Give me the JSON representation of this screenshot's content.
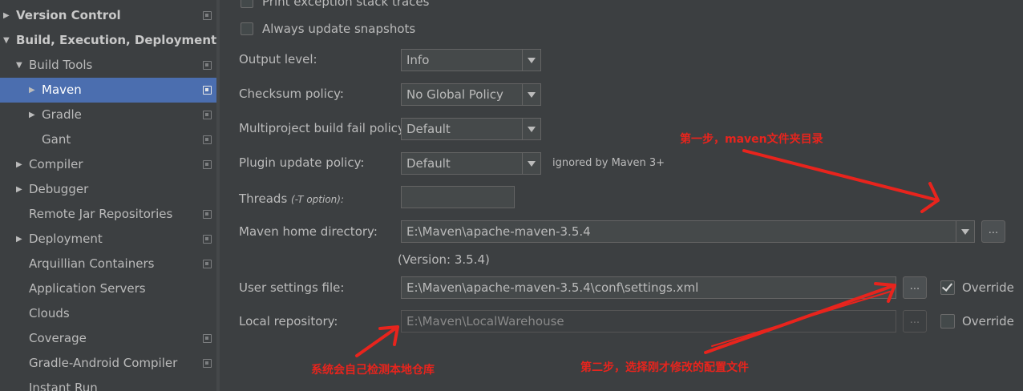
{
  "sidebar": {
    "items": [
      {
        "label": "Version Control",
        "level": 0,
        "bold": true,
        "arrow": "right",
        "copy": true
      },
      {
        "label": "Build, Execution, Deployment",
        "level": 0,
        "bold": true,
        "arrow": "down",
        "copy": false
      },
      {
        "label": "Build Tools",
        "level": 1,
        "bold": false,
        "arrow": "down",
        "copy": true
      },
      {
        "label": "Maven",
        "level": 2,
        "bold": false,
        "arrow": "right",
        "copy": true,
        "selected": true
      },
      {
        "label": "Gradle",
        "level": 2,
        "bold": false,
        "arrow": "right",
        "copy": true
      },
      {
        "label": "Gant",
        "level": 2,
        "bold": false,
        "arrow": "",
        "copy": true
      },
      {
        "label": "Compiler",
        "level": 1,
        "bold": false,
        "arrow": "right",
        "copy": true
      },
      {
        "label": "Debugger",
        "level": 1,
        "bold": false,
        "arrow": "right",
        "copy": false
      },
      {
        "label": "Remote Jar Repositories",
        "level": 1,
        "bold": false,
        "arrow": "",
        "copy": true
      },
      {
        "label": "Deployment",
        "level": 1,
        "bold": false,
        "arrow": "right",
        "copy": true
      },
      {
        "label": "Arquillian Containers",
        "level": 1,
        "bold": false,
        "arrow": "",
        "copy": true
      },
      {
        "label": "Application Servers",
        "level": 1,
        "bold": false,
        "arrow": "",
        "copy": false
      },
      {
        "label": "Clouds",
        "level": 1,
        "bold": false,
        "arrow": "",
        "copy": false
      },
      {
        "label": "Coverage",
        "level": 1,
        "bold": false,
        "arrow": "",
        "copy": true
      },
      {
        "label": "Gradle-Android Compiler",
        "level": 1,
        "bold": false,
        "arrow": "",
        "copy": true
      },
      {
        "label": "Instant Run",
        "level": 1,
        "bold": false,
        "arrow": "",
        "copy": false
      }
    ]
  },
  "form": {
    "print_exception": {
      "label": "Print exception stack traces",
      "checked": false
    },
    "always_update": {
      "label": "Always update snapshots",
      "checked": false
    },
    "output_level": {
      "label": "Output level:",
      "value": "Info"
    },
    "checksum_policy": {
      "label": "Checksum policy:",
      "value": "No Global Policy"
    },
    "multiproject_fail": {
      "label": "Multiproject build fail policy:",
      "value": "Default"
    },
    "plugin_update": {
      "label": "Plugin update policy:",
      "value": "Default",
      "note": "ignored by Maven 3+"
    },
    "threads": {
      "label": "Threads",
      "hint": "(-T option):",
      "value": ""
    },
    "maven_home": {
      "label": "Maven home directory:",
      "value": "E:\\Maven\\apache-maven-3.5.4",
      "version": "(Version: 3.5.4)",
      "browse": "..."
    },
    "user_settings": {
      "label": "User settings file:",
      "value": "E:\\Maven\\apache-maven-3.5.4\\conf\\settings.xml",
      "browse": "...",
      "override_label": "Override",
      "override_checked": true
    },
    "local_repo": {
      "label": "Local repository:",
      "value": "E:\\Maven\\LocalWarehouse",
      "browse": "...",
      "override_label": "Override",
      "override_checked": false
    }
  },
  "annotations": {
    "step1": "第一步，maven文件夹目录",
    "step2": "第二步，选择刚才修改的配置文件",
    "auto_detect": "系统会自己检测本地仓库"
  },
  "colors": {
    "accent_selection": "#4b6eaf",
    "annotation_red": "#e8241d"
  }
}
